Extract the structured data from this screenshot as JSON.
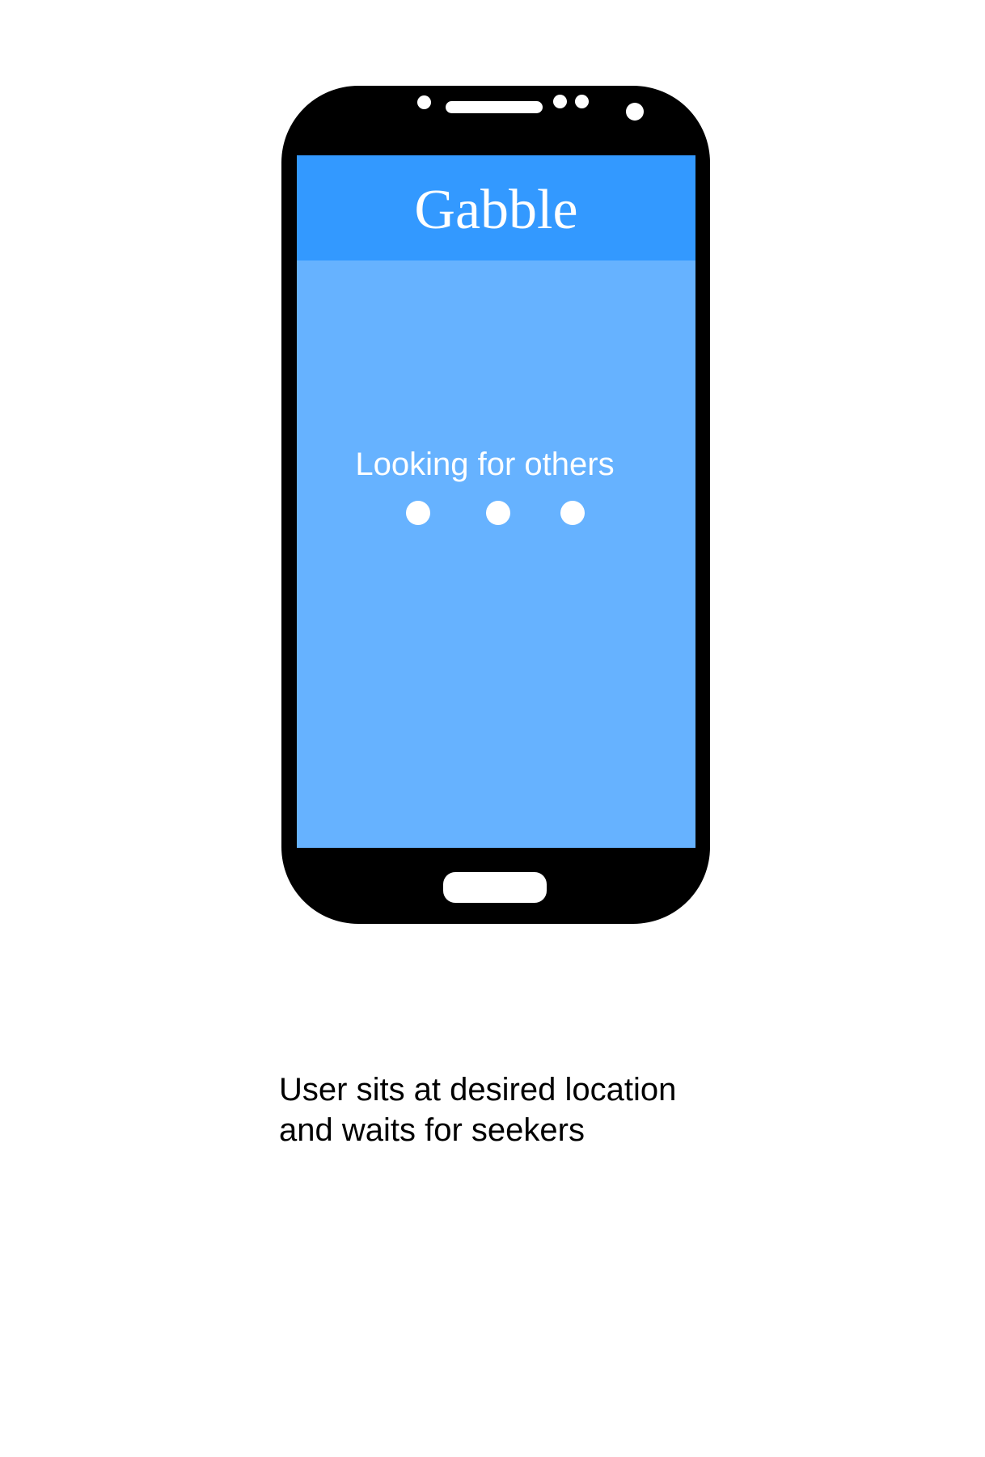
{
  "app": {
    "title": "Gabble"
  },
  "screen": {
    "status_text": "Looking for others",
    "loading_dots": 3
  },
  "caption": {
    "line1": "User sits at desired location",
    "line2": "and waits for seekers"
  },
  "colors": {
    "phone_body": "#000000",
    "header": "#3399ff",
    "screen_background": "#66b2ff",
    "text_on_screen": "#ffffff",
    "caption_text": "#000000"
  }
}
